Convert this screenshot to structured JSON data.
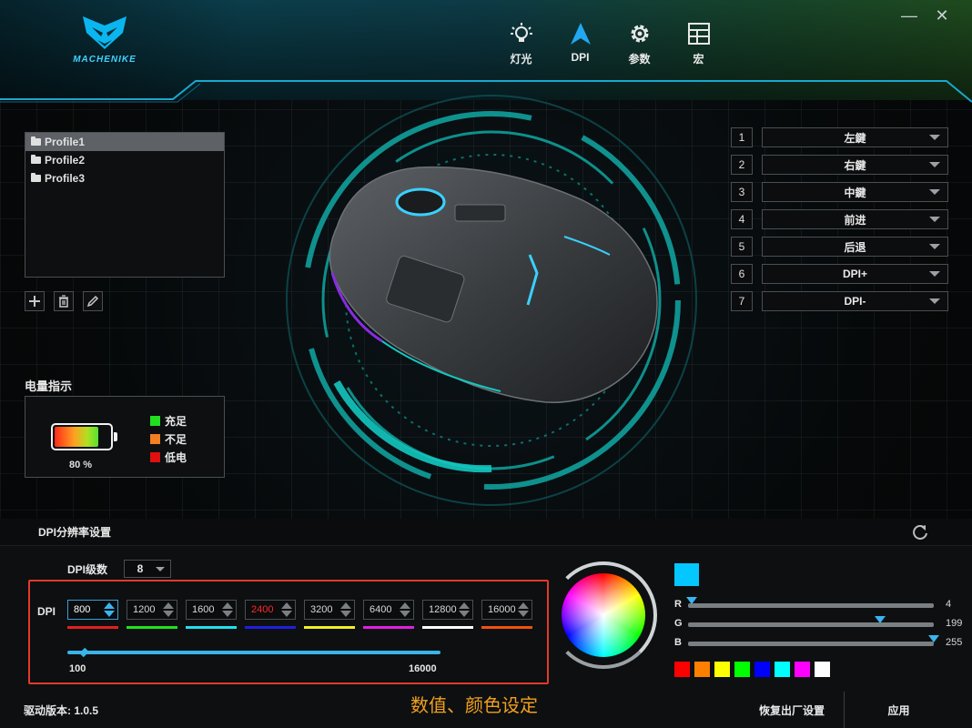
{
  "brand": {
    "logo_text": "MACHENIKE"
  },
  "nav": [
    {
      "label": "灯光",
      "icon": "light-bulb-icon"
    },
    {
      "label": "DPI",
      "icon": "dpi-arrow-icon"
    },
    {
      "label": "参数",
      "icon": "gear-icon"
    },
    {
      "label": "宏",
      "icon": "macro-grid-icon"
    }
  ],
  "window": {
    "minimize": "—",
    "close": "✕"
  },
  "profiles": [
    "Profile1",
    "Profile2",
    "Profile3"
  ],
  "profile_selected": 0,
  "profile_tools": [
    "add-icon",
    "trash-icon",
    "pencil-icon"
  ],
  "battery": {
    "title": "电量指示",
    "percent_label": "80 %",
    "level": 0.8,
    "legend": [
      {
        "label": "充足",
        "color": "#20e020"
      },
      {
        "label": "不足",
        "color": "#f08020"
      },
      {
        "label": "低电",
        "color": "#e01010"
      }
    ]
  },
  "buttons": [
    {
      "num": "1",
      "label": "左鍵"
    },
    {
      "num": "2",
      "label": "右鍵"
    },
    {
      "num": "3",
      "label": "中鍵"
    },
    {
      "num": "4",
      "label": "前进"
    },
    {
      "num": "5",
      "label": "后退"
    },
    {
      "num": "6",
      "label": "DPI+"
    },
    {
      "num": "7",
      "label": "DPI-"
    }
  ],
  "dpi_panel": {
    "title": "DPI分辨率设置",
    "levels_label": "DPI级数",
    "levels_value": "8",
    "row_label": "DPI",
    "values": [
      {
        "v": "800",
        "color": "#e02020",
        "text_color": "#ffffff",
        "active": true
      },
      {
        "v": "1200",
        "color": "#20e020",
        "text_color": "#d8d8d8",
        "active": false
      },
      {
        "v": "1600",
        "color": "#20e0f0",
        "text_color": "#d8d8d8",
        "active": false
      },
      {
        "v": "2400",
        "color": "#2020e0",
        "text_color": "#ff2a2a",
        "active": false
      },
      {
        "v": "3200",
        "color": "#f0f020",
        "text_color": "#d8d8d8",
        "active": false
      },
      {
        "v": "6400",
        "color": "#e020e0",
        "text_color": "#d8d8d8",
        "active": false
      },
      {
        "v": "12800",
        "color": "#ffffff",
        "text_color": "#d8d8d8",
        "active": false
      },
      {
        "v": "16000",
        "color": "#f05010",
        "text_color": "#d8d8d8",
        "active": false
      }
    ],
    "slider_min": "100",
    "slider_max": "16000",
    "slider_value": 800
  },
  "color": {
    "current": "#04c7ff",
    "r": 4,
    "g": 199,
    "b": 255,
    "r_label": "R",
    "g_label": "G",
    "b_label": "B",
    "r_text": "4",
    "g_text": "199",
    "b_text": "255",
    "presets": [
      "#ff0000",
      "#ff8000",
      "#ffff00",
      "#00ff00",
      "#0000ff",
      "#00ffff",
      "#ff00ff",
      "#ffffff"
    ]
  },
  "caption": "数值、颜色设定",
  "footer": {
    "version": "驱动版本: 1.0.5",
    "restore": "恢复出厂设置",
    "apply": "应用"
  }
}
